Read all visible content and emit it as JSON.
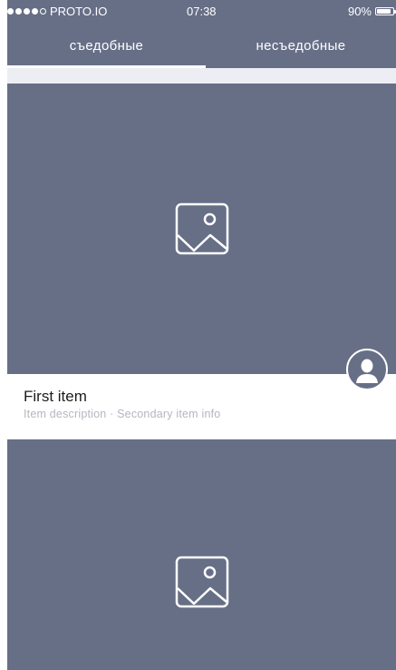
{
  "status_bar": {
    "carrier": "PROTO.IO",
    "time": "07:38",
    "battery_text": "90%",
    "battery_level": 0.9,
    "signal_bars_filled": 4,
    "signal_bars_total": 5
  },
  "tabs": [
    {
      "label": "съедобные",
      "active": true
    },
    {
      "label": "несъедобные",
      "active": false
    }
  ],
  "cards": [
    {
      "image_icon": "image-placeholder-icon",
      "avatar_icon": "user-avatar-icon",
      "title": "First item",
      "description": "Item description · Secondary item info"
    },
    {
      "image_icon": "image-placeholder-icon"
    }
  ],
  "colors": {
    "header_bg": "#676f87",
    "image_bg": "#676f87",
    "separator_bg": "#eceef4",
    "title_text": "#1c1c1c",
    "secondary_text": "#b4b7c0"
  }
}
